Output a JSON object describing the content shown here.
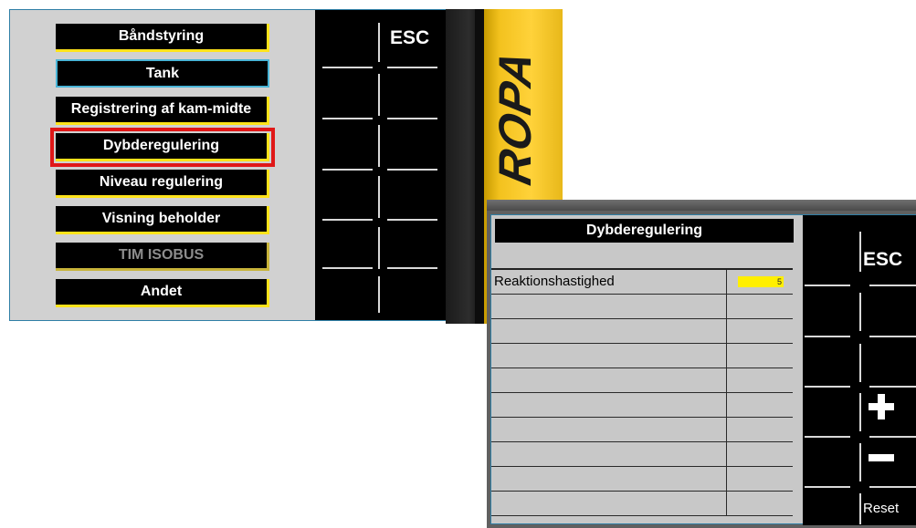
{
  "menu": {
    "items": [
      {
        "label": "Båndstyring"
      },
      {
        "label": "Tank"
      },
      {
        "label": "Registrering af kam-midte"
      },
      {
        "label": "Dybderegulering"
      },
      {
        "label": "Niveau regulering"
      },
      {
        "label": "Visning beholder"
      },
      {
        "label": "TIM ISOBUS"
      },
      {
        "label": "Andet"
      }
    ],
    "esc_label": "ESC"
  },
  "device": {
    "brand": "ROPA"
  },
  "detail": {
    "title": "Dybderegulering",
    "rows": [
      {
        "label": "Reaktionshastighed",
        "value": "5"
      }
    ],
    "esc_label": "ESC",
    "reset_label": "Reset"
  },
  "colors": {
    "accent_yellow": "#ffe31a",
    "highlight_red": "#e01818",
    "frame_blue": "#2f7fa6"
  }
}
